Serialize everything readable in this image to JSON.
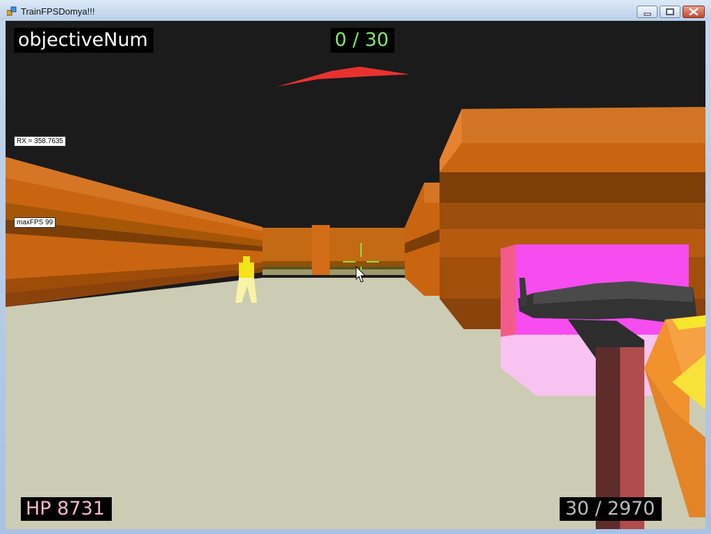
{
  "window": {
    "title": "TrainFPSDomya!!!"
  },
  "hud": {
    "objective_label": "objectiveNum",
    "objective_count": "0 / 30",
    "debug_rx": "RX = 358.7635",
    "debug_fps": "maxFPS 99",
    "hp": "HP  8731",
    "ammo": "30 / 2970"
  },
  "colors": {
    "sky": "#1b1b1b",
    "floor": "#cccbb3",
    "wall_orange": "#c96510",
    "enemy": "#f3e01e",
    "crosshair": "#8ee23b",
    "objective_count_text": "#7df06a",
    "hp_text": "#f7b9c8",
    "ammo_text": "#bcbcbc"
  },
  "icons": {
    "app": "app-icon",
    "minimize": "minimize-icon",
    "maximize": "maximize-icon",
    "close": "close-icon",
    "cursor": "mouse-cursor-icon",
    "crosshair": "crosshair-icon"
  }
}
